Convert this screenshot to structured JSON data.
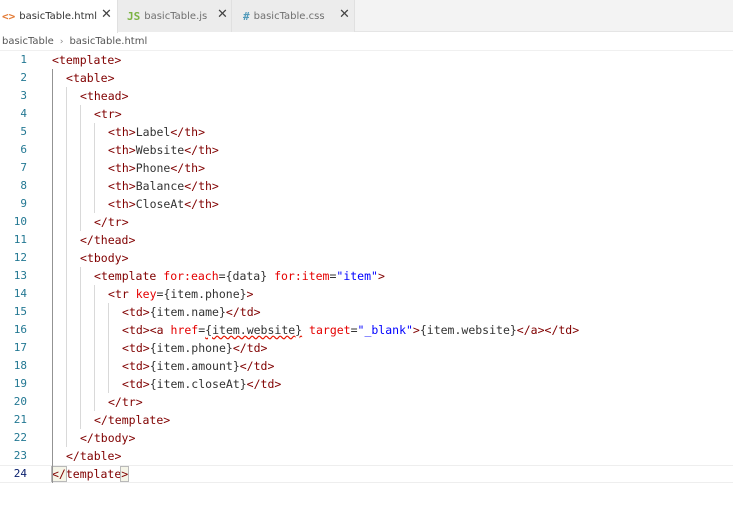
{
  "tabs": [
    {
      "icon": "<>",
      "icon_color": "#e37933",
      "label": "basicTable.html",
      "active": true
    },
    {
      "icon": "JS",
      "icon_color": "#7cb342",
      "label": "basicTable.js",
      "active": false
    },
    {
      "icon": "#",
      "icon_color": "#519aba",
      "label": "basicTable.css",
      "active": false
    }
  ],
  "close_glyph": "✕",
  "breadcrumb": [
    "basicTable",
    "basicTable.html"
  ],
  "breadcrumb_sep": "›",
  "current_line": 24,
  "lines": [
    {
      "n": "1",
      "indent": 0,
      "tokens": [
        [
          "br",
          "<"
        ],
        [
          "tag",
          "template"
        ],
        [
          "br",
          ">"
        ]
      ]
    },
    {
      "n": "2",
      "indent": 1,
      "tokens": [
        [
          "br",
          "<"
        ],
        [
          "tag",
          "table"
        ],
        [
          "br",
          ">"
        ]
      ]
    },
    {
      "n": "3",
      "indent": 2,
      "tokens": [
        [
          "br",
          "<"
        ],
        [
          "tag",
          "thead"
        ],
        [
          "br",
          ">"
        ]
      ]
    },
    {
      "n": "4",
      "indent": 3,
      "tokens": [
        [
          "br",
          "<"
        ],
        [
          "tag",
          "tr"
        ],
        [
          "br",
          ">"
        ]
      ]
    },
    {
      "n": "5",
      "indent": 4,
      "tokens": [
        [
          "br",
          "<"
        ],
        [
          "tag",
          "th"
        ],
        [
          "br",
          ">"
        ],
        [
          "txt",
          "Label"
        ],
        [
          "br",
          "</"
        ],
        [
          "tag",
          "th"
        ],
        [
          "br",
          ">"
        ]
      ]
    },
    {
      "n": "6",
      "indent": 4,
      "tokens": [
        [
          "br",
          "<"
        ],
        [
          "tag",
          "th"
        ],
        [
          "br",
          ">"
        ],
        [
          "txt",
          "Website"
        ],
        [
          "br",
          "</"
        ],
        [
          "tag",
          "th"
        ],
        [
          "br",
          ">"
        ]
      ]
    },
    {
      "n": "7",
      "indent": 4,
      "tokens": [
        [
          "br",
          "<"
        ],
        [
          "tag",
          "th"
        ],
        [
          "br",
          ">"
        ],
        [
          "txt",
          "Phone"
        ],
        [
          "br",
          "</"
        ],
        [
          "tag",
          "th"
        ],
        [
          "br",
          ">"
        ]
      ]
    },
    {
      "n": "8",
      "indent": 4,
      "tokens": [
        [
          "br",
          "<"
        ],
        [
          "tag",
          "th"
        ],
        [
          "br",
          ">"
        ],
        [
          "txt",
          "Balance"
        ],
        [
          "br",
          "</"
        ],
        [
          "tag",
          "th"
        ],
        [
          "br",
          ">"
        ]
      ]
    },
    {
      "n": "9",
      "indent": 4,
      "tokens": [
        [
          "br",
          "<"
        ],
        [
          "tag",
          "th"
        ],
        [
          "br",
          ">"
        ],
        [
          "txt",
          "CloseAt"
        ],
        [
          "br",
          "</"
        ],
        [
          "tag",
          "th"
        ],
        [
          "br",
          ">"
        ]
      ]
    },
    {
      "n": "10",
      "indent": 3,
      "tokens": [
        [
          "br",
          "</"
        ],
        [
          "tag",
          "tr"
        ],
        [
          "br",
          ">"
        ]
      ]
    },
    {
      "n": "11",
      "indent": 2,
      "tokens": [
        [
          "br",
          "</"
        ],
        [
          "tag",
          "thead"
        ],
        [
          "br",
          ">"
        ]
      ]
    },
    {
      "n": "12",
      "indent": 2,
      "tokens": [
        [
          "br",
          "<"
        ],
        [
          "tag",
          "tbody"
        ],
        [
          "br",
          ">"
        ]
      ]
    },
    {
      "n": "13",
      "indent": 3,
      "tokens": [
        [
          "br",
          "<"
        ],
        [
          "tag",
          "template"
        ],
        [
          "txt",
          " "
        ],
        [
          "attr",
          "for:each"
        ],
        [
          "eq",
          "="
        ],
        [
          "txt",
          "{data}"
        ],
        [
          "txt",
          " "
        ],
        [
          "attr",
          "for:item"
        ],
        [
          "eq",
          "="
        ],
        [
          "str",
          "\"item\""
        ],
        [
          "br",
          ">"
        ]
      ]
    },
    {
      "n": "14",
      "indent": 4,
      "tokens": [
        [
          "br",
          "<"
        ],
        [
          "tag",
          "tr"
        ],
        [
          "txt",
          " "
        ],
        [
          "attr",
          "key"
        ],
        [
          "eq",
          "="
        ],
        [
          "txt",
          "{item.phone}"
        ],
        [
          "br",
          ">"
        ]
      ]
    },
    {
      "n": "15",
      "indent": 5,
      "tokens": [
        [
          "br",
          "<"
        ],
        [
          "tag",
          "td"
        ],
        [
          "br",
          ">"
        ],
        [
          "txt",
          "{item.name}"
        ],
        [
          "br",
          "</"
        ],
        [
          "tag",
          "td"
        ],
        [
          "br",
          ">"
        ]
      ]
    },
    {
      "n": "16",
      "indent": 5,
      "tokens": [
        [
          "br",
          "<"
        ],
        [
          "tag",
          "td"
        ],
        [
          "br",
          "><"
        ],
        [
          "tag",
          "a"
        ],
        [
          "txt",
          " "
        ],
        [
          "attr",
          "href"
        ],
        [
          "eq",
          "="
        ],
        [
          "err",
          "{item.website}"
        ],
        [
          "txt",
          " "
        ],
        [
          "attr",
          "target"
        ],
        [
          "eq",
          "="
        ],
        [
          "str",
          "\"_blank\""
        ],
        [
          "br",
          ">"
        ],
        [
          "txt",
          "{item.website}"
        ],
        [
          "br",
          "</"
        ],
        [
          "tag",
          "a"
        ],
        [
          "br",
          "></"
        ],
        [
          "tag",
          "td"
        ],
        [
          "br",
          ">"
        ]
      ]
    },
    {
      "n": "17",
      "indent": 5,
      "tokens": [
        [
          "br",
          "<"
        ],
        [
          "tag",
          "td"
        ],
        [
          "br",
          ">"
        ],
        [
          "txt",
          "{item.phone}"
        ],
        [
          "br",
          "</"
        ],
        [
          "tag",
          "td"
        ],
        [
          "br",
          ">"
        ]
      ]
    },
    {
      "n": "18",
      "indent": 5,
      "tokens": [
        [
          "br",
          "<"
        ],
        [
          "tag",
          "td"
        ],
        [
          "br",
          ">"
        ],
        [
          "txt",
          "{item.amount}"
        ],
        [
          "br",
          "</"
        ],
        [
          "tag",
          "td"
        ],
        [
          "br",
          ">"
        ]
      ]
    },
    {
      "n": "19",
      "indent": 5,
      "tokens": [
        [
          "br",
          "<"
        ],
        [
          "tag",
          "td"
        ],
        [
          "br",
          ">"
        ],
        [
          "txt",
          "{item.closeAt}"
        ],
        [
          "br",
          "</"
        ],
        [
          "tag",
          "td"
        ],
        [
          "br",
          ">"
        ]
      ]
    },
    {
      "n": "20",
      "indent": 4,
      "tokens": [
        [
          "br",
          "</"
        ],
        [
          "tag",
          "tr"
        ],
        [
          "br",
          ">"
        ]
      ]
    },
    {
      "n": "21",
      "indent": 3,
      "tokens": [
        [
          "br",
          "</"
        ],
        [
          "tag",
          "template"
        ],
        [
          "br",
          ">"
        ]
      ]
    },
    {
      "n": "22",
      "indent": 2,
      "tokens": [
        [
          "br",
          "</"
        ],
        [
          "tag",
          "tbody"
        ],
        [
          "br",
          ">"
        ]
      ]
    },
    {
      "n": "23",
      "indent": 1,
      "tokens": [
        [
          "br",
          "</"
        ],
        [
          "tag",
          "table"
        ],
        [
          "br",
          ">"
        ]
      ]
    },
    {
      "n": "24",
      "indent": 0,
      "tokens": [
        [
          "br",
          "</"
        ],
        [
          "tag",
          "template"
        ],
        [
          "br",
          ">"
        ]
      ]
    }
  ]
}
